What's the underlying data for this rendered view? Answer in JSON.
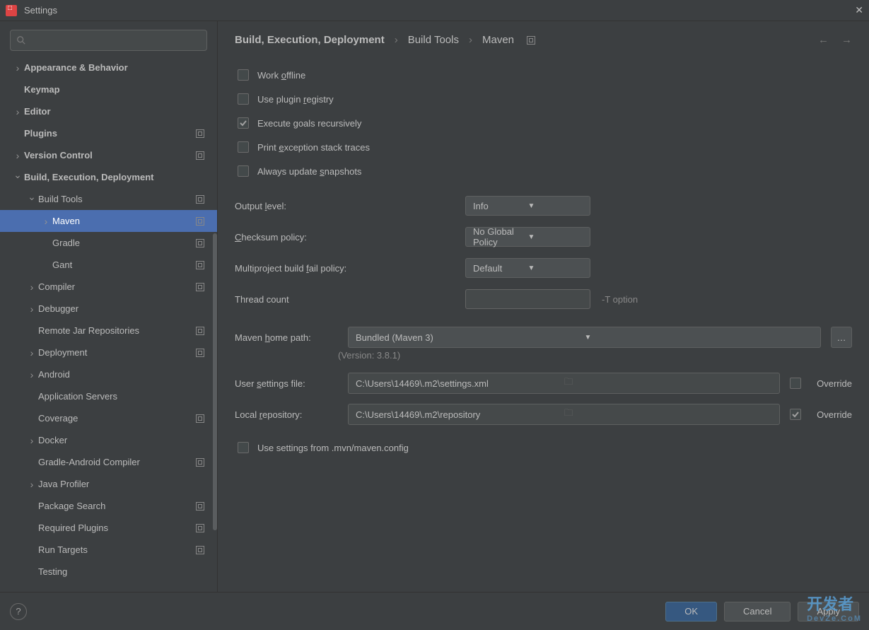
{
  "window": {
    "title": "Settings"
  },
  "breadcrumbs": {
    "a": "Build, Execution, Deployment",
    "b": "Build Tools",
    "c": "Maven"
  },
  "sidebar": {
    "items": [
      {
        "label": "Appearance & Behavior",
        "level": 0,
        "chev": "collapsed",
        "bold": true,
        "sq": false
      },
      {
        "label": "Keymap",
        "level": 0,
        "chev": "none",
        "bold": true,
        "sq": false
      },
      {
        "label": "Editor",
        "level": 0,
        "chev": "collapsed",
        "bold": true,
        "sq": false
      },
      {
        "label": "Plugins",
        "level": 0,
        "chev": "none",
        "bold": true,
        "sq": true
      },
      {
        "label": "Version Control",
        "level": 0,
        "chev": "collapsed",
        "bold": true,
        "sq": true
      },
      {
        "label": "Build, Execution, Deployment",
        "level": 0,
        "chev": "expanded",
        "bold": true,
        "sq": false
      },
      {
        "label": "Build Tools",
        "level": 1,
        "chev": "expanded",
        "bold": false,
        "sq": true
      },
      {
        "label": "Maven",
        "level": 2,
        "chev": "collapsed",
        "bold": false,
        "sq": true,
        "selected": true
      },
      {
        "label": "Gradle",
        "level": 2,
        "chev": "none",
        "bold": false,
        "sq": true
      },
      {
        "label": "Gant",
        "level": 2,
        "chev": "none",
        "bold": false,
        "sq": true
      },
      {
        "label": "Compiler",
        "level": 1,
        "chev": "collapsed",
        "bold": false,
        "sq": true
      },
      {
        "label": "Debugger",
        "level": 1,
        "chev": "collapsed",
        "bold": false,
        "sq": false
      },
      {
        "label": "Remote Jar Repositories",
        "level": 1,
        "chev": "none",
        "bold": false,
        "sq": true
      },
      {
        "label": "Deployment",
        "level": 1,
        "chev": "collapsed",
        "bold": false,
        "sq": true
      },
      {
        "label": "Android",
        "level": 1,
        "chev": "collapsed",
        "bold": false,
        "sq": false
      },
      {
        "label": "Application Servers",
        "level": 1,
        "chev": "none",
        "bold": false,
        "sq": false
      },
      {
        "label": "Coverage",
        "level": 1,
        "chev": "none",
        "bold": false,
        "sq": true
      },
      {
        "label": "Docker",
        "level": 1,
        "chev": "collapsed",
        "bold": false,
        "sq": false
      },
      {
        "label": "Gradle-Android Compiler",
        "level": 1,
        "chev": "none",
        "bold": false,
        "sq": true
      },
      {
        "label": "Java Profiler",
        "level": 1,
        "chev": "collapsed",
        "bold": false,
        "sq": false
      },
      {
        "label": "Package Search",
        "level": 1,
        "chev": "none",
        "bold": false,
        "sq": true
      },
      {
        "label": "Required Plugins",
        "level": 1,
        "chev": "none",
        "bold": false,
        "sq": true
      },
      {
        "label": "Run Targets",
        "level": 1,
        "chev": "none",
        "bold": false,
        "sq": true
      },
      {
        "label": "Testing",
        "level": 1,
        "chev": "none",
        "bold": false,
        "sq": false
      }
    ]
  },
  "checks": {
    "work_offline": "Work offline",
    "plugin_registry": "Use plugin registry",
    "execute_goals": "Execute goals recursively",
    "print_exception": "Print exception stack traces",
    "always_update": "Always update snapshots",
    "mvn_config": "Use settings from .mvn/maven.config"
  },
  "fields": {
    "output_level": {
      "label": "Output level:",
      "value": "Info"
    },
    "checksum": {
      "label": "Checksum policy:",
      "value": "No Global Policy"
    },
    "multiproject": {
      "label": "Multiproject build fail policy:",
      "value": "Default"
    },
    "thread_count": {
      "label": "Thread count",
      "value": "",
      "hint": "-T option"
    },
    "home_path": {
      "label": "Maven home path:",
      "value": "Bundled (Maven 3)",
      "version": "(Version: 3.8.1)"
    },
    "settings_file": {
      "label": "User settings file:",
      "value": "C:\\Users\\14469\\.m2\\settings.xml",
      "override": "Override",
      "override_checked": false
    },
    "local_repo": {
      "label": "Local repository:",
      "value": "C:\\Users\\14469\\.m2\\repository",
      "override": "Override",
      "override_checked": true
    }
  },
  "buttons": {
    "ok": "OK",
    "cancel": "Cancel",
    "apply": "Apply"
  },
  "watermark": {
    "main": "开发者",
    "sub": "DevZe.CoM"
  }
}
